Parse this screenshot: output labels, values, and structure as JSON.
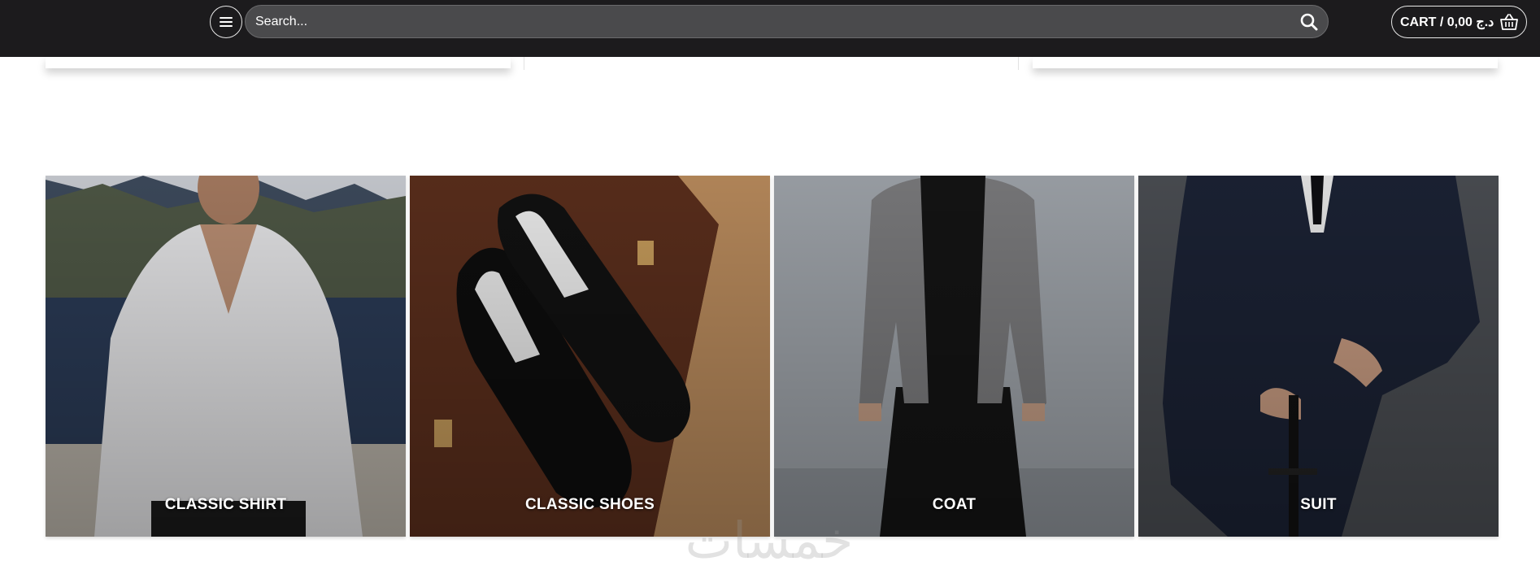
{
  "header": {
    "menu_icon": "hamburger-menu-icon",
    "search": {
      "placeholder": "Search...",
      "value": "",
      "icon": "search-icon"
    },
    "cart": {
      "label": "CART / 0,00 د.ج",
      "icon": "basket-icon"
    }
  },
  "categories": [
    {
      "label": "CLASSIC SHIRT",
      "icon": "shirt-photo"
    },
    {
      "label": "CLASSIC SHOES",
      "icon": "shoes-photo"
    },
    {
      "label": "COAT",
      "icon": "coat-photo"
    },
    {
      "label": "SUIT",
      "icon": "suit-photo"
    }
  ],
  "watermark": {
    "text": "خمسات"
  },
  "colors": {
    "header_bg": "#1c1b1d",
    "search_bg": "#4a4a4c",
    "text_light": "#ffffff"
  }
}
